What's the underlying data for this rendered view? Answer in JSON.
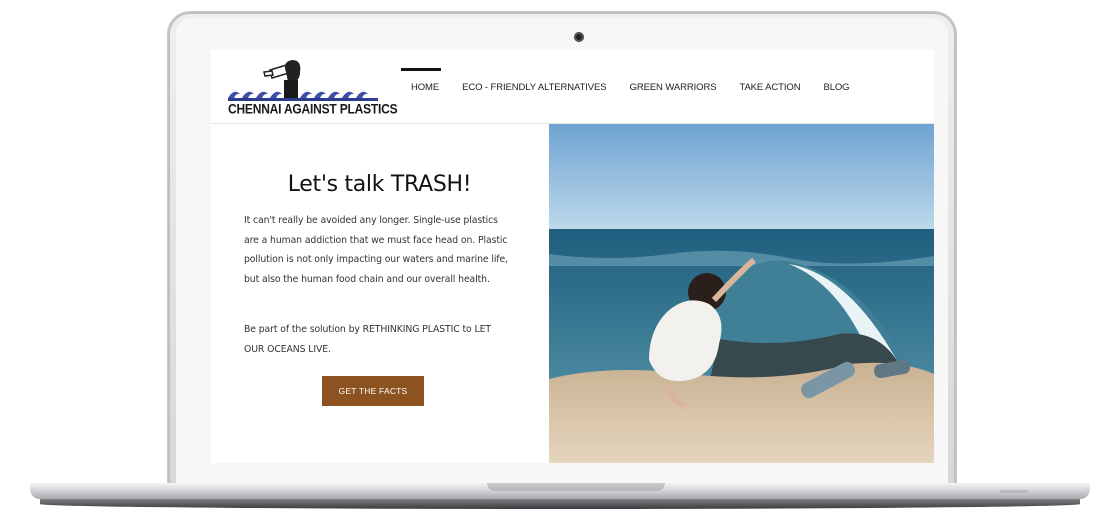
{
  "site": {
    "logo_text": "CHENNAI AGAINST PLASTICS",
    "nav": [
      {
        "label": "HOME",
        "active": true
      },
      {
        "label": "ECO - FRIENDLY ALTERNATIVES",
        "active": false
      },
      {
        "label": "GREEN WARRIORS",
        "active": false
      },
      {
        "label": "TAKE ACTION",
        "active": false
      },
      {
        "label": "BLOG",
        "active": false
      }
    ]
  },
  "hero": {
    "title": "Let's talk TRASH!",
    "paragraph_1": "It can't really be avoided any longer. Single-use plastics are a human addiction that we must face head on. Plastic pollution is not only impacting our waters and marine life, but also the human food chain and our overall health.",
    "paragraph_2": "Be part of the solution by RETHINKING PLASTIC to LET OUR OCEANS LIVE.",
    "cta_label": "GET THE FACTS"
  },
  "colors": {
    "cta": "#8c5320",
    "logo_wave": "#3d4fa8",
    "sky_top": "#6fa3d2",
    "sea": "#2f6f8d",
    "sand": "#d8c4a8"
  }
}
